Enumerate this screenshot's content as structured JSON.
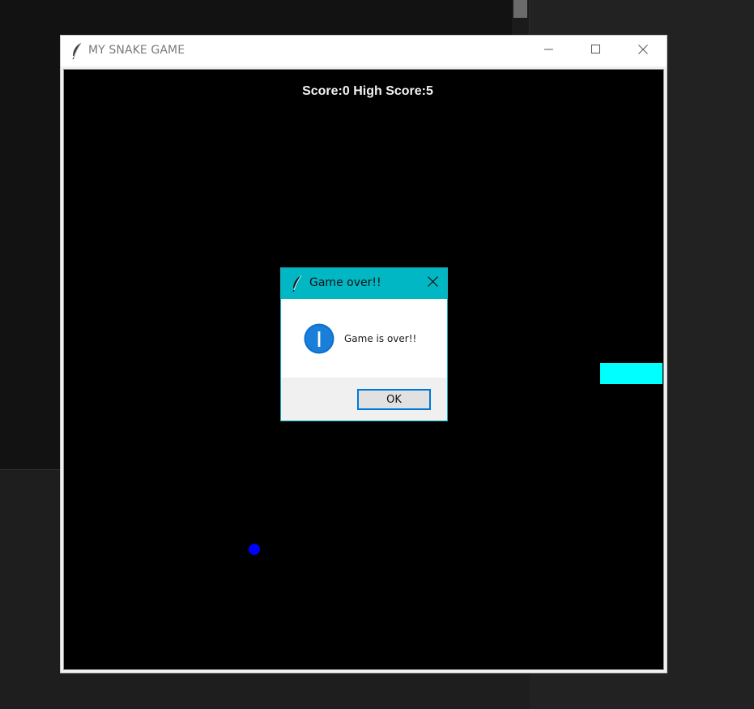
{
  "window": {
    "title": "MY SNAKE GAME",
    "title_icon": "feather-icon",
    "controls": [
      "minimize-icon",
      "maximize-icon",
      "close-icon"
    ]
  },
  "game": {
    "score_text": "Score:0 High Score:5",
    "score": 0,
    "high_score": 5,
    "colors": {
      "background": "#000000",
      "snake": "#00ffff",
      "food": "#0000ff",
      "score_text": "#f2f2f2"
    }
  },
  "dialog": {
    "title": "Game over!!",
    "title_icon": "feather-icon",
    "message": "Game is over!!",
    "message_icon": "info-icon",
    "ok_label": "OK",
    "colors": {
      "titlebar": "#00b7c3",
      "button_border": "#0078d7",
      "info_icon": "#0078d7"
    }
  }
}
